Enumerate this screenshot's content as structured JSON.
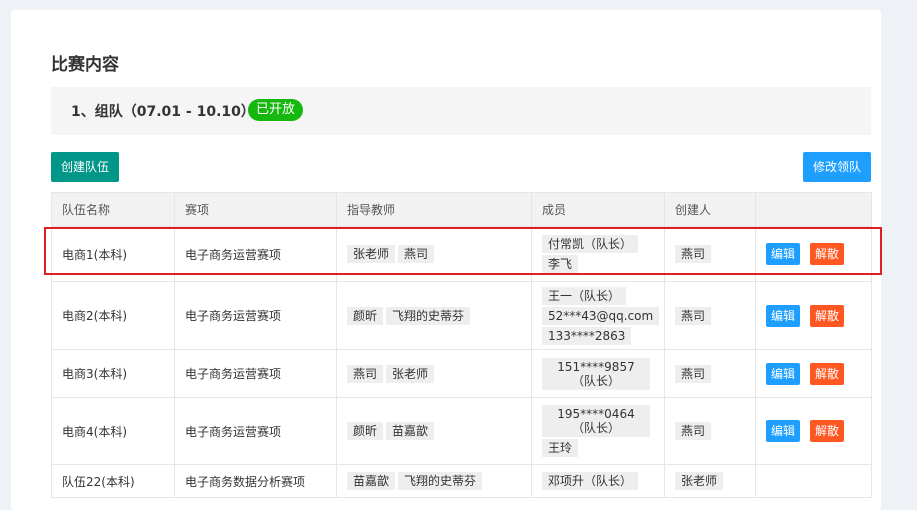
{
  "section_title": "比赛内容",
  "stage": {
    "title": "1、组队（07.01 - 10.10）",
    "status": "已开放"
  },
  "buttons": {
    "create_team": "创建队伍",
    "modify_leader": "修改领队"
  },
  "table": {
    "headers": [
      "队伍名称",
      "赛项",
      "指导教师",
      "成员",
      "创建人",
      ""
    ],
    "op_edit": "编辑",
    "op_disband": "解散",
    "rows": [
      {
        "name": "电商1(本科)",
        "event": "电子商务运营赛项",
        "teachers": [
          "张老师",
          "燕司"
        ],
        "members": [
          "付常凯（队长）",
          "李飞"
        ],
        "creator": "燕司"
      },
      {
        "name": "电商2(本科)",
        "event": "电子商务运营赛项",
        "teachers": [
          "颜昕",
          "飞翔的史蒂芬"
        ],
        "members": [
          "王一（队长）",
          "52***43@qq.com",
          "133****2863"
        ],
        "creator": "燕司"
      },
      {
        "name": "电商3(本科)",
        "event": "电子商务运营赛项",
        "teachers": [
          "燕司",
          "张老师"
        ],
        "members": [
          "151****9857（队长）"
        ],
        "creator": "燕司"
      },
      {
        "name": "电商4(本科)",
        "event": "电子商务运营赛项",
        "teachers": [
          "颜昕",
          "苗嘉歆"
        ],
        "members": [
          "195****0464（队长）",
          "王玲"
        ],
        "creator": "燕司"
      },
      {
        "name": "队伍22(本科)",
        "event": "电子商务数据分析赛项",
        "teachers": [
          "苗嘉歆",
          "飞翔的史蒂芬"
        ],
        "members": [
          "邓项升（队长）"
        ],
        "creator": "张老师"
      }
    ]
  }
}
